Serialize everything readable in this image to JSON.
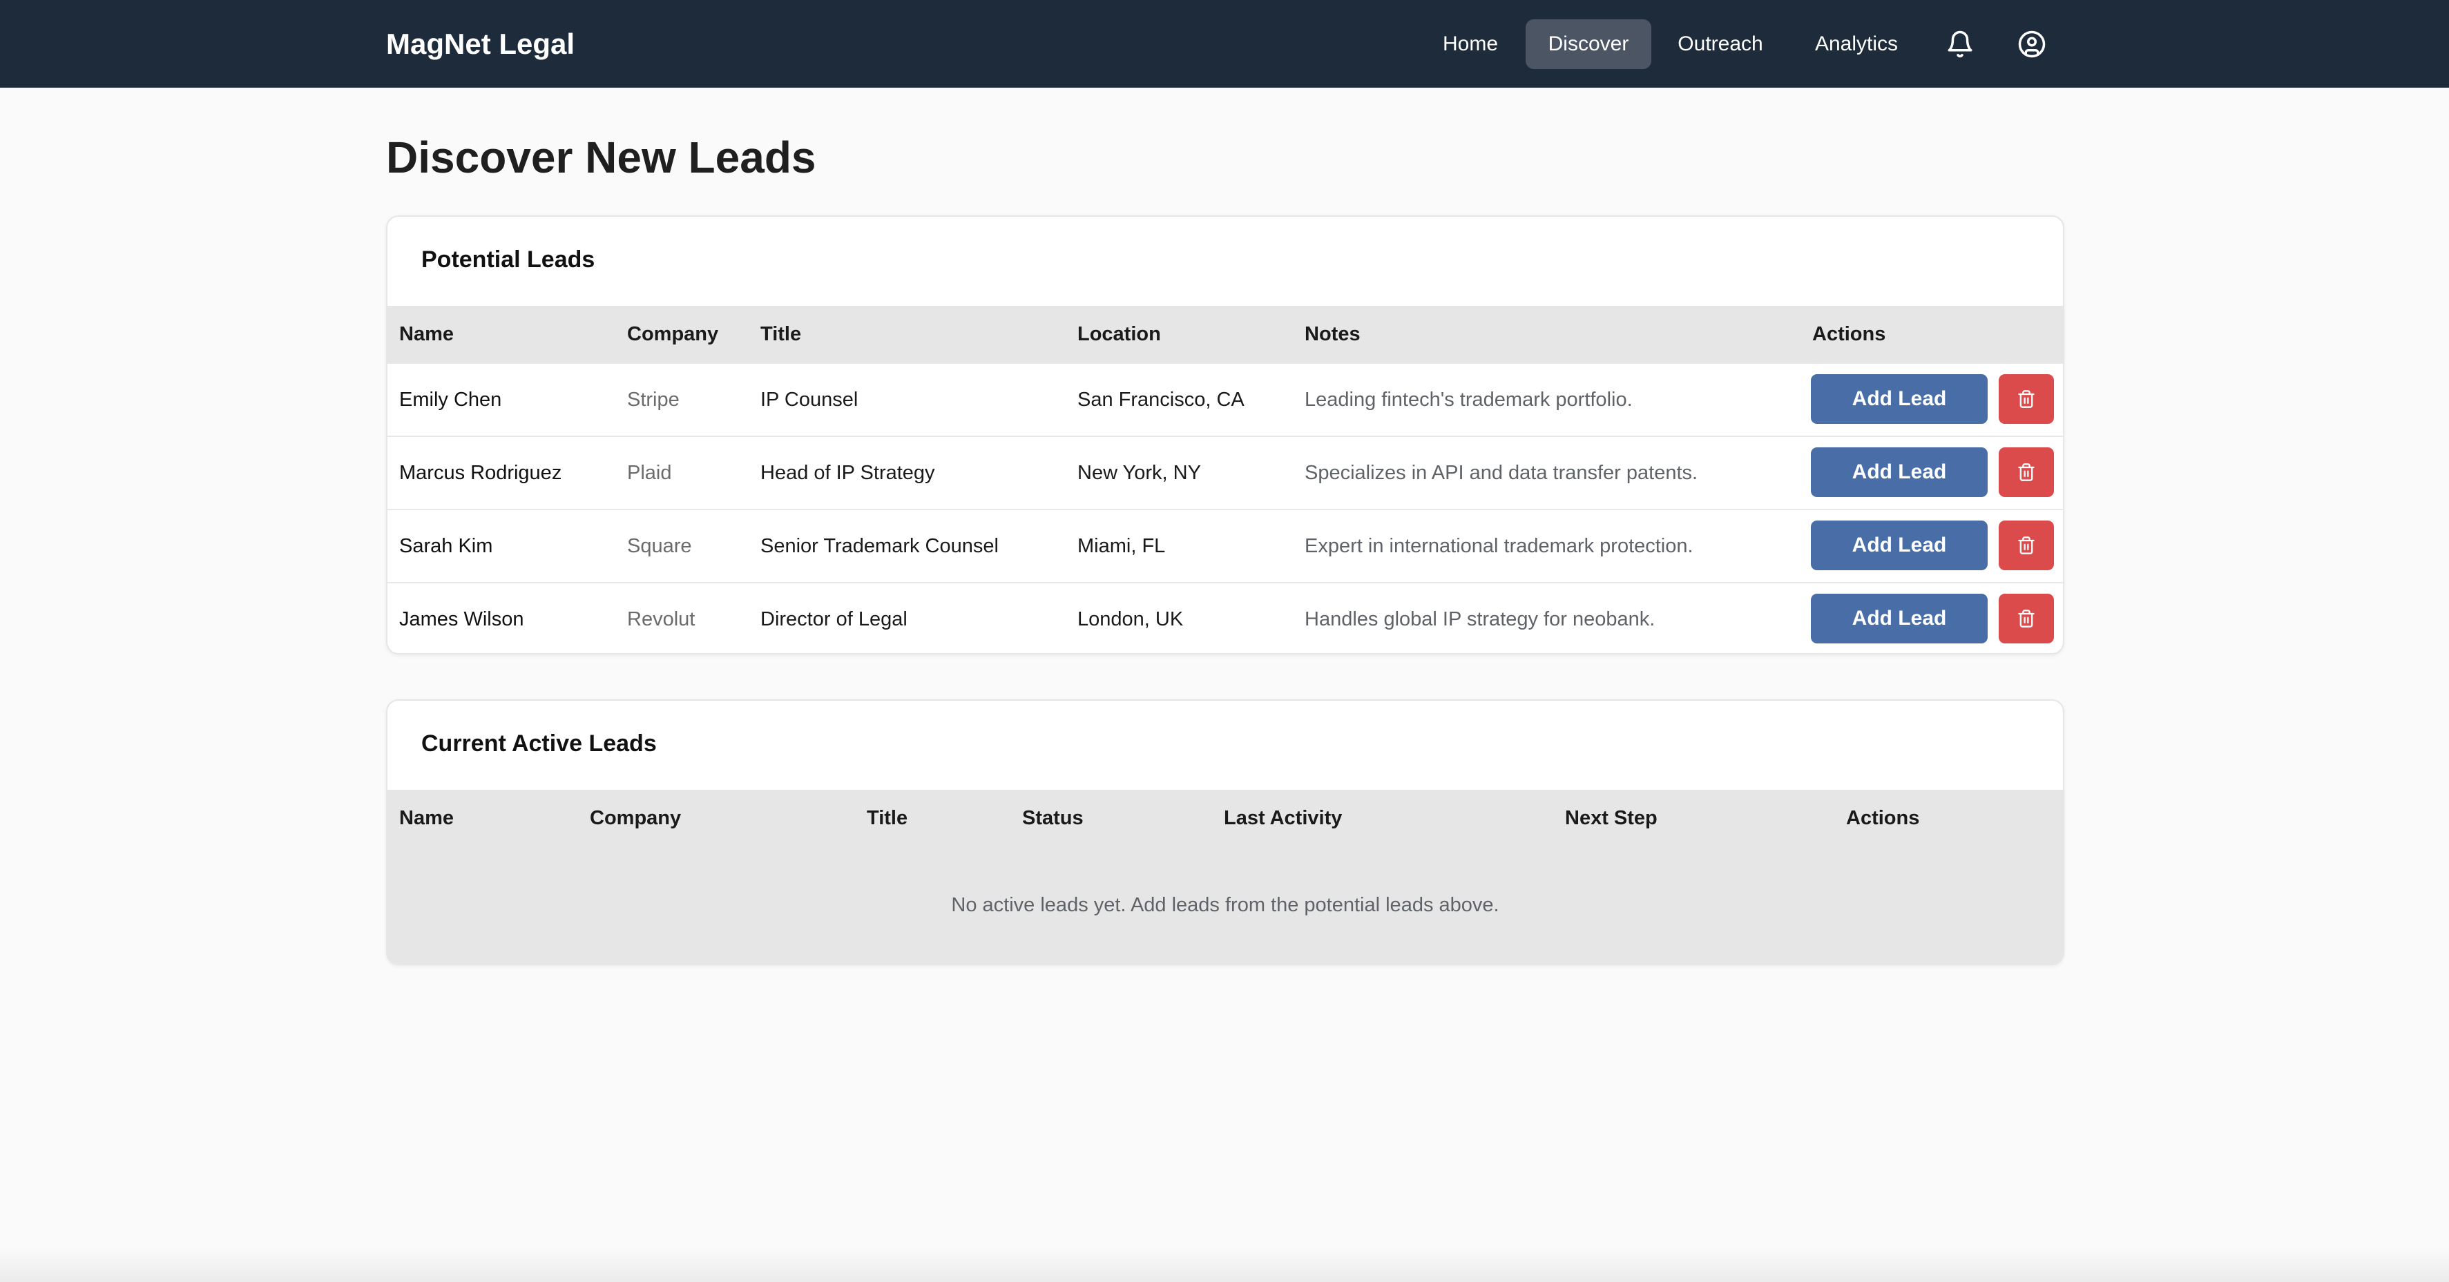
{
  "app": {
    "brand": "MagNet Legal"
  },
  "nav": {
    "items": [
      {
        "label": "Home",
        "active": false
      },
      {
        "label": "Discover",
        "active": true
      },
      {
        "label": "Outreach",
        "active": false
      },
      {
        "label": "Analytics",
        "active": false
      }
    ],
    "icons": [
      "bell-icon",
      "user-circle-icon"
    ]
  },
  "page": {
    "title": "Discover New Leads"
  },
  "potential_leads": {
    "title": "Potential Leads",
    "columns": [
      "Name",
      "Company",
      "Title",
      "Location",
      "Notes",
      "Actions"
    ],
    "add_label": "Add Lead",
    "rows": [
      {
        "name": "Emily Chen",
        "company": "Stripe",
        "title": "IP Counsel",
        "location": "San Francisco, CA",
        "notes": "Leading fintech's trademark portfolio."
      },
      {
        "name": "Marcus Rodriguez",
        "company": "Plaid",
        "title": "Head of IP Strategy",
        "location": "New York, NY",
        "notes": "Specializes in API and data transfer patents."
      },
      {
        "name": "Sarah Kim",
        "company": "Square",
        "title": "Senior Trademark Counsel",
        "location": "Miami, FL",
        "notes": "Expert in international trademark protection."
      },
      {
        "name": "James Wilson",
        "company": "Revolut",
        "title": "Director of Legal",
        "location": "London, UK",
        "notes": "Handles global IP strategy for neobank."
      }
    ]
  },
  "active_leads": {
    "title": "Current Active Leads",
    "columns": [
      "Name",
      "Company",
      "Title",
      "Status",
      "Last Activity",
      "Next Step",
      "Actions"
    ],
    "empty_message": "No active leads yet. Add leads from the potential leads above."
  },
  "colors": {
    "topbar": "#1e2b3a",
    "nav_active": "#4b5563",
    "add_button": "#496da6",
    "delete_button": "#dc4b4b",
    "table_header": "#e6e6e6"
  }
}
